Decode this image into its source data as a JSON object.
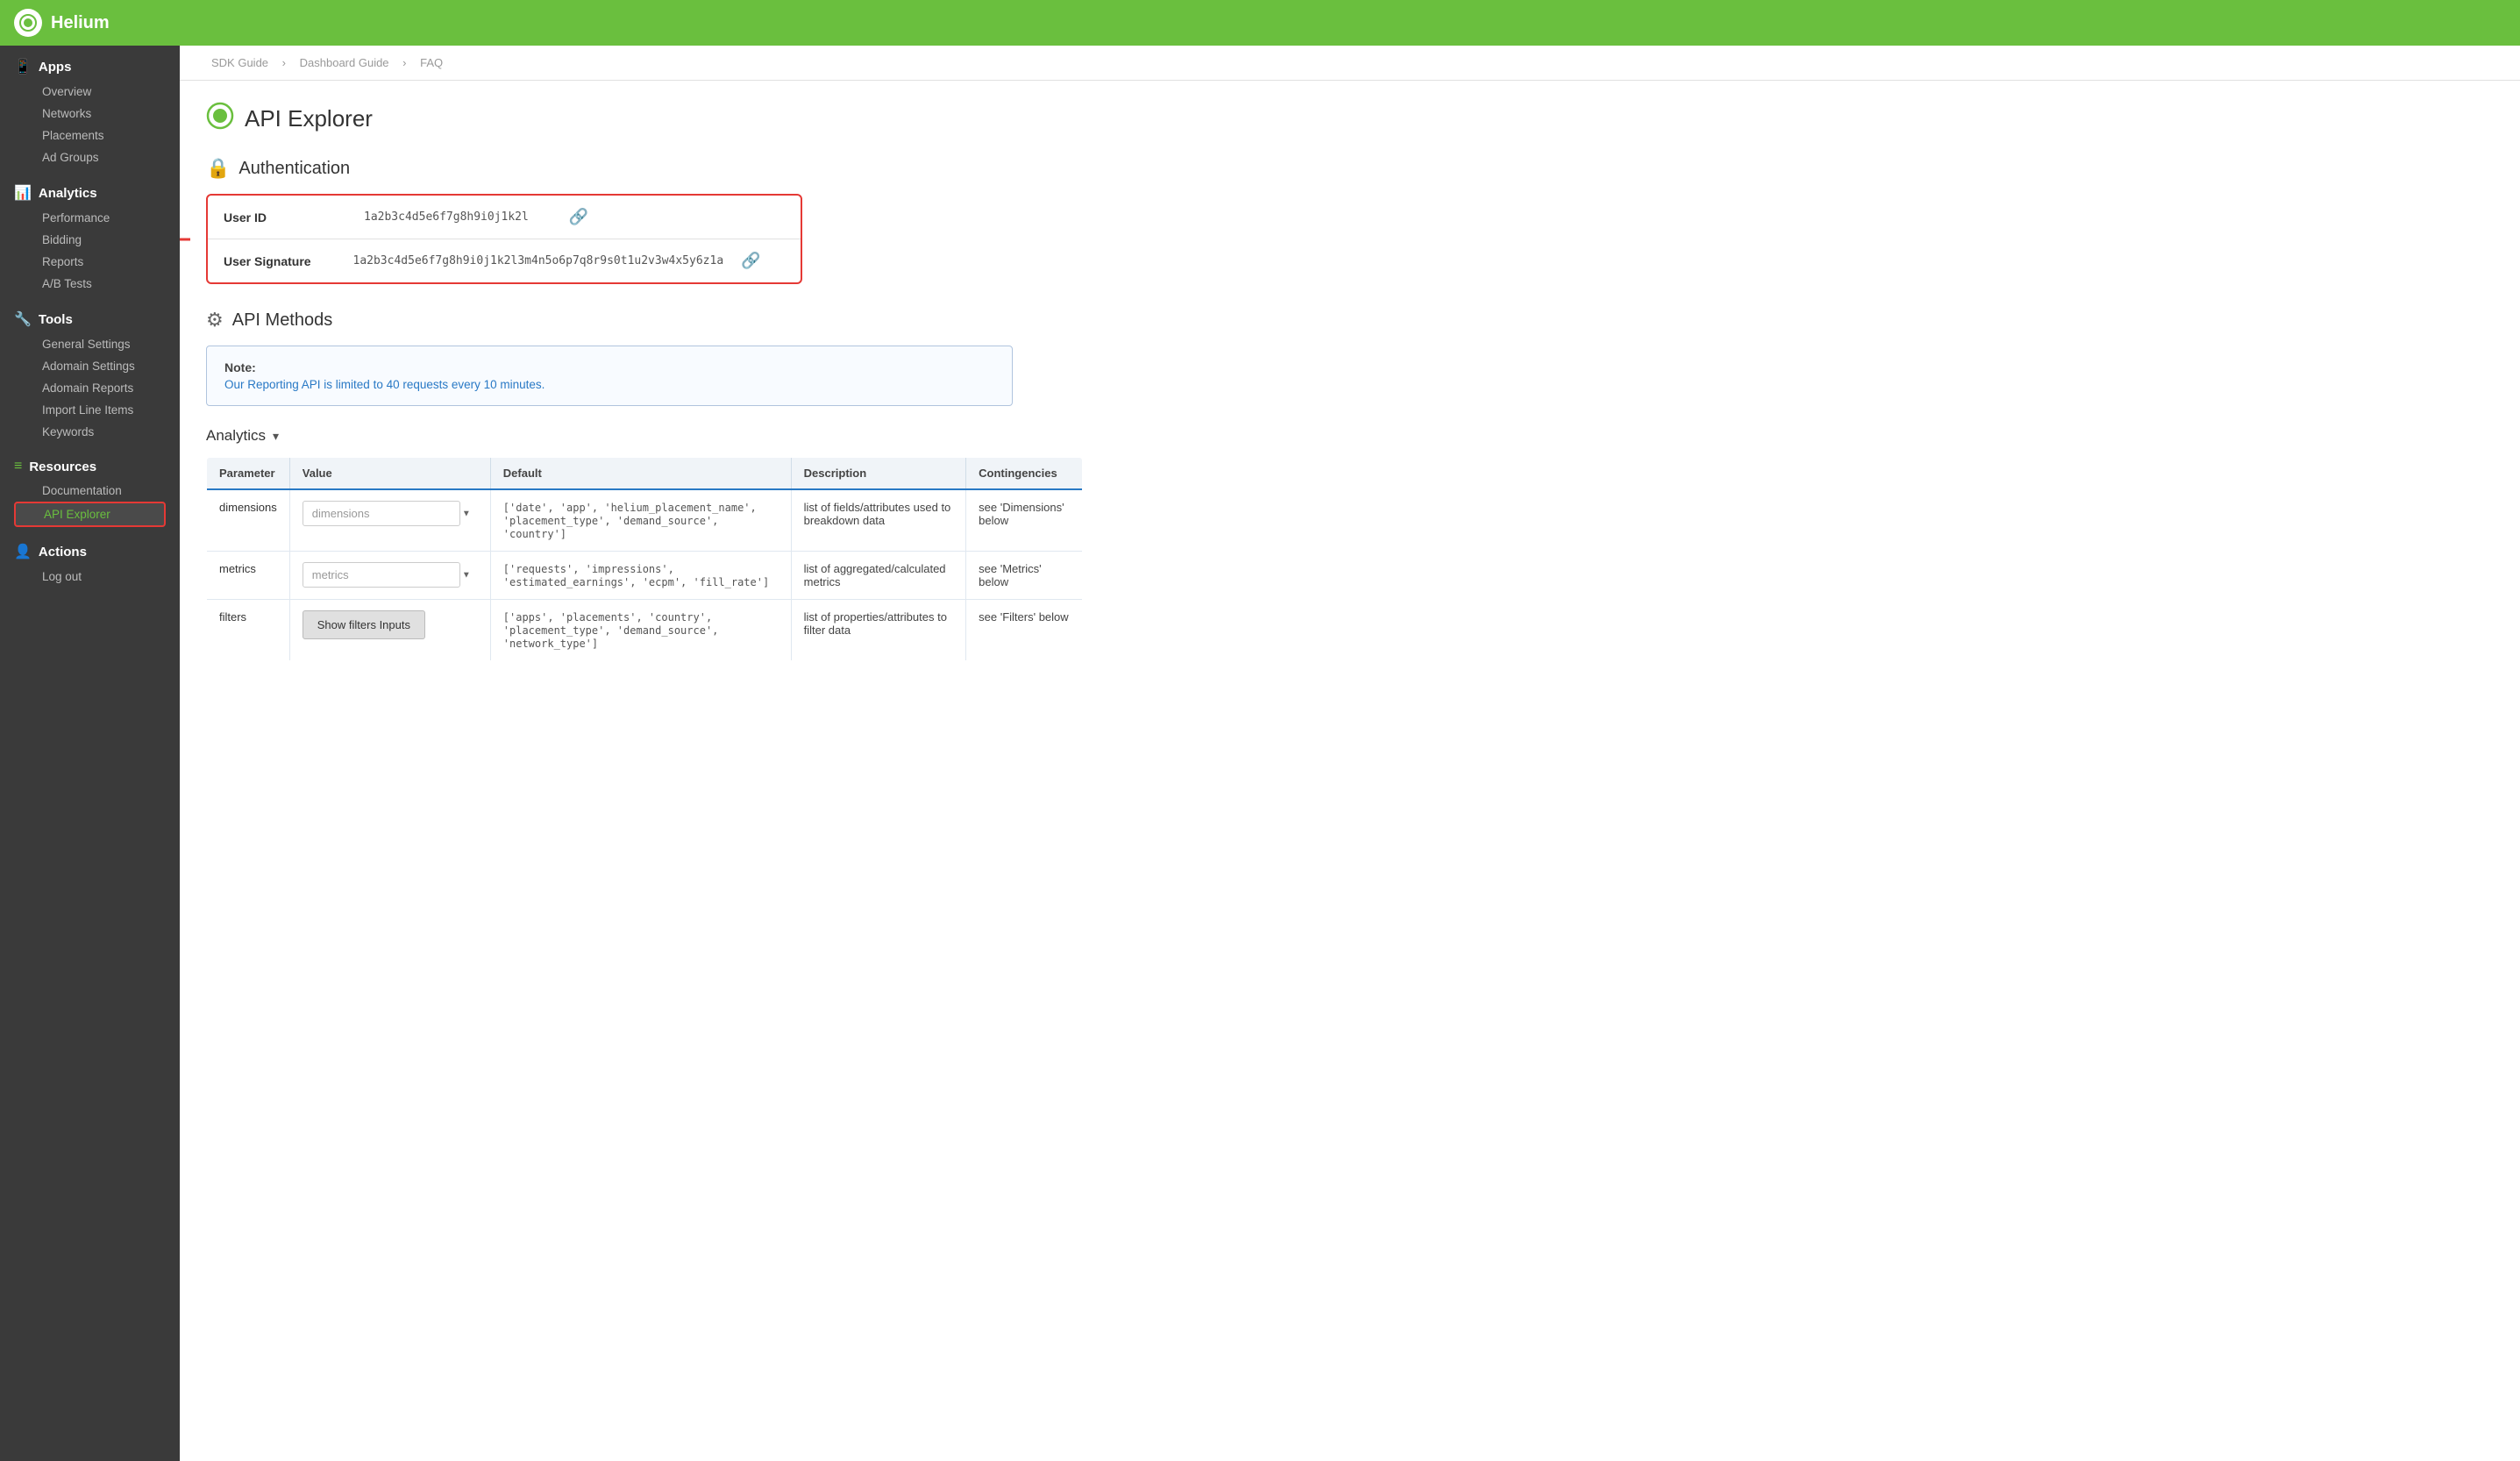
{
  "topbar": {
    "app_name": "Helium"
  },
  "breadcrumb": {
    "items": [
      "SDK Guide",
      "Dashboard Guide",
      "FAQ"
    ],
    "separator": "›"
  },
  "page": {
    "title": "API Explorer",
    "title_icon": "●"
  },
  "auth_section": {
    "title": "Authentication",
    "user_id_label": "User ID",
    "user_id_value": "1a2b3c4d5e6f7g8h9i0j1k2l",
    "user_signature_label": "User Signature",
    "user_signature_value": "1a2b3c4d5e6f7g8h9i0j1k2l3m4n5o6p7q8r9s0t1u2v3w4x5y6z1a"
  },
  "api_methods": {
    "title": "API Methods",
    "note_title": "Note:",
    "note_text": "Our Reporting API is limited to 40 requests every 10 minutes.",
    "analytics_label": "Analytics",
    "table": {
      "columns": [
        "Parameter",
        "Value",
        "Default",
        "Description",
        "Contingencies"
      ],
      "rows": [
        {
          "parameter": "dimensions",
          "value_placeholder": "dimensions",
          "default": "['date', 'app', 'helium_placement_name', 'placement_type', 'demand_source', 'country']",
          "description": "list of fields/attributes used to breakdown data",
          "contingencies": "see 'Dimensions' below"
        },
        {
          "parameter": "metrics",
          "value_placeholder": "metrics",
          "default": "['requests', 'impressions', 'estimated_earnings', 'ecpm', 'fill_rate']",
          "description": "list of aggregated/calculated metrics",
          "contingencies": "see 'Metrics' below"
        },
        {
          "parameter": "filters",
          "value_button": "Show filters Inputs",
          "default": "['apps', 'placements', 'country', 'placement_type', 'demand_source', 'network_type']",
          "description": "list of properties/attributes to filter data",
          "contingencies": "see 'Filters' below"
        }
      ]
    }
  },
  "sidebar": {
    "logo_label": "Helium",
    "sections": [
      {
        "id": "apps",
        "icon": "☐",
        "title": "Apps",
        "items": [
          {
            "id": "overview",
            "label": "Overview"
          },
          {
            "id": "networks",
            "label": "Networks"
          },
          {
            "id": "placements",
            "label": "Placements"
          },
          {
            "id": "ad-groups",
            "label": "Ad Groups"
          }
        ]
      },
      {
        "id": "analytics",
        "icon": "📊",
        "title": "Analytics",
        "items": [
          {
            "id": "performance",
            "label": "Performance"
          },
          {
            "id": "bidding",
            "label": "Bidding"
          },
          {
            "id": "reports",
            "label": "Reports"
          },
          {
            "id": "ab-tests",
            "label": "A/B Tests"
          }
        ]
      },
      {
        "id": "tools",
        "icon": "🔧",
        "title": "Tools",
        "items": [
          {
            "id": "general-settings",
            "label": "General Settings"
          },
          {
            "id": "adomain-settings",
            "label": "Adomain Settings"
          },
          {
            "id": "adomain-reports",
            "label": "Adomain Reports"
          },
          {
            "id": "import-line-items",
            "label": "Import Line Items"
          },
          {
            "id": "keywords",
            "label": "Keywords"
          }
        ]
      },
      {
        "id": "resources",
        "icon": "≡",
        "title": "Resources",
        "items": [
          {
            "id": "documentation",
            "label": "Documentation"
          },
          {
            "id": "api-explorer",
            "label": "API Explorer",
            "active": true
          }
        ]
      },
      {
        "id": "actions",
        "icon": "👤",
        "title": "Actions",
        "items": [
          {
            "id": "log-out",
            "label": "Log out"
          }
        ]
      }
    ]
  }
}
